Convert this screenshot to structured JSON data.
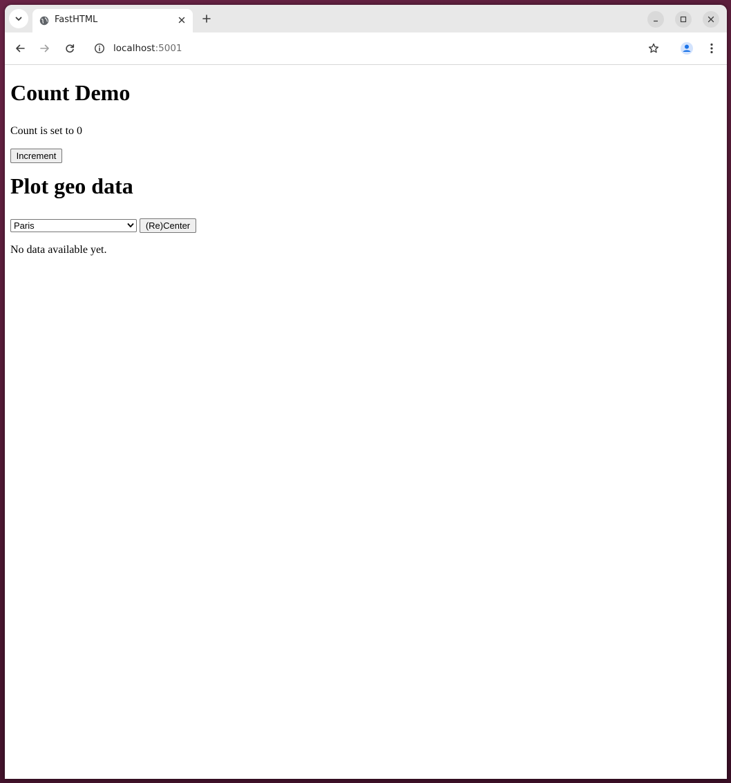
{
  "browser": {
    "tab": {
      "title": "FastHTML"
    },
    "address": {
      "host": "localhost",
      "port": ":5001"
    }
  },
  "page": {
    "count_demo": {
      "heading": "Count Demo",
      "count_text": "Count is set to 0",
      "increment_label": "Increment"
    },
    "plot_geo": {
      "heading": "Plot geo data",
      "selected_city": "Paris",
      "recenter_label": "(Re)Center",
      "status_text": "No data available yet."
    }
  },
  "icons": {
    "tab_search": "chevron-down-icon",
    "favicon": "globe-icon",
    "tab_close": "close-icon",
    "new_tab": "plus-icon",
    "minimize": "minimize-icon",
    "maximize": "maximize-icon",
    "close_window": "close-icon",
    "back": "arrow-left-icon",
    "forward": "arrow-right-icon",
    "reload": "reload-icon",
    "site_info": "info-icon",
    "bookmark": "star-icon",
    "profile": "profile-icon",
    "menu": "kebab-menu-icon"
  },
  "colors": {
    "desktop": "#5b1f3c",
    "tabstrip": "#e8e8e8",
    "profile_accent": "#1a73e8"
  }
}
